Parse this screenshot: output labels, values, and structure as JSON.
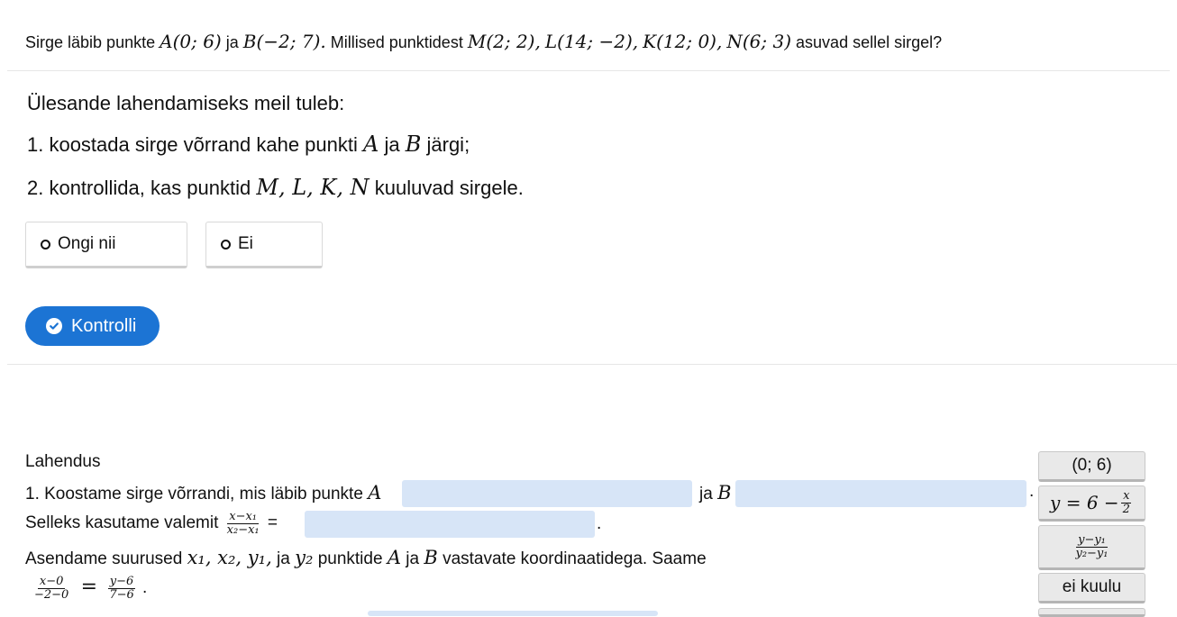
{
  "question": {
    "prefix": "Sirge läbib punkte",
    "pointA": "A(0; 6)",
    "ja": "ja",
    "pointB": "B(−2; 7).",
    "middle": "Millised punktidest",
    "pointM": "M(2; 2),",
    "pointL": "L(14; −2),",
    "pointK": "K(12; 0),",
    "pointN": "N(6; 3)",
    "suffix": "asuvad sellel sirgel?"
  },
  "intro": {
    "heading": "Ülesande lahendamiseks meil tuleb:",
    "step1_prefix": "1. koostada sirge võrrand kahe punkti",
    "step1_A": "A",
    "step1_ja": "ja",
    "step1_B": "B",
    "step1_suffix": "järgi;",
    "step2_prefix": "2. kontrollida, kas punktid",
    "step2_points": "M, L, K, N",
    "step2_suffix": "kuuluvad sirgele."
  },
  "options": [
    {
      "label": "Ongi nii"
    },
    {
      "label": "Ei"
    }
  ],
  "check_button": {
    "label": "Kontrolli",
    "color": "#1c74d4"
  },
  "solution": {
    "title": "Lahendus",
    "line1_prefix": "1. Koostame sirge võrrandi, mis läbib punkte",
    "line1_A": "A",
    "line1_ja": "ja",
    "line1_B": "B",
    "line1_end": ".",
    "line2_prefix": "Selleks kasutame valemit",
    "line2_frac_num": "x−x₁",
    "line2_frac_den": "x₂−x₁",
    "line2_eq": "=",
    "line2_end": ".",
    "line3_prefix": "Asendame suurused",
    "line3_vars": "x₁, x₂, y₁,",
    "line3_ja": "ja",
    "line3_y2": "y₂",
    "line3_middle": "punktide",
    "line3_A": "A",
    "line3_ja2": "ja",
    "line3_B": "B",
    "line3_suffix": "vastavate koordinaatidega. Saame",
    "line4_frac1_num": "x−0",
    "line4_frac1_den": "−2−0",
    "line4_eq": "=",
    "line4_frac2_num": "y−6",
    "line4_frac2_den": "7−6",
    "line4_end": "."
  },
  "answer_chips": {
    "chip1": "(0; 6)",
    "chip2_left": "y = 6 −",
    "chip2_frac_num": "x",
    "chip2_frac_den": "2",
    "chip3_frac_num": "y−y₁",
    "chip3_frac_den": "y₂−y₁",
    "chip4": "ei kuulu"
  },
  "colors": {
    "blank_fill": "#d7e5f7",
    "chip_fill": "#e9e9e9",
    "accent": "#1c74d4"
  }
}
